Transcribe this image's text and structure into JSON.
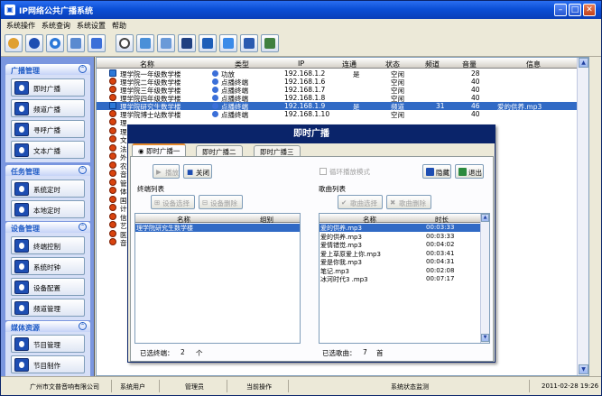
{
  "window": {
    "title": "IP网络公共广播系统"
  },
  "menu": [
    "系统操作",
    "系统查询",
    "系统设置",
    "帮助"
  ],
  "toolbar_icons": [
    "users-icon",
    "broadcast-icon",
    "spinner-icon",
    "edit-icon",
    "book-icon",
    "clock-icon",
    "folder-icon",
    "tree-icon",
    "monitor-icon",
    "antenna-icon",
    "snow-icon",
    "film-icon",
    "exit-icon"
  ],
  "sidebar": {
    "groups": [
      {
        "title": "广播管理",
        "items": [
          "即时广播",
          "频道广播",
          "寻呼广播",
          "文本广播"
        ]
      },
      {
        "title": "任务管理",
        "items": [
          "系统定时",
          "本地定时"
        ]
      },
      {
        "title": "设备管理",
        "items": [
          "终端控制",
          "系统时钟",
          "设备配置",
          "频道管理"
        ]
      },
      {
        "title": "媒体资源",
        "items": [
          "节目管理",
          "节目制作"
        ]
      }
    ]
  },
  "grid": {
    "columns": [
      "名称",
      "类型",
      "IP",
      "连通",
      "状态",
      "频道",
      "音量",
      "信息"
    ],
    "rows": [
      {
        "name": "理学院一年级数学楼",
        "type": "功放",
        "ip": "192.168.1.2",
        "conn": "是",
        "status": "空闲",
        "channel": "",
        "volume": "28",
        "info": "",
        "icon": "net"
      },
      {
        "name": "理学院二年级数学楼",
        "type": "点播终端",
        "ip": "192.168.1.6",
        "conn": "",
        "status": "空闲",
        "channel": "",
        "volume": "40",
        "info": "",
        "icon": "off"
      },
      {
        "name": "理学院三年级数学楼",
        "type": "点播终端",
        "ip": "192.168.1.7",
        "conn": "",
        "status": "空闲",
        "channel": "",
        "volume": "40",
        "info": "",
        "icon": "off"
      },
      {
        "name": "理学院四年级数学楼",
        "type": "点播终端",
        "ip": "192.168.1.8",
        "conn": "",
        "status": "空闲",
        "channel": "",
        "volume": "40",
        "info": "",
        "icon": "off"
      },
      {
        "name": "理学院研究生数学楼",
        "type": "点播终端",
        "ip": "192.168.1.9",
        "conn": "是",
        "status": "频道",
        "channel": "31",
        "volume": "46",
        "info": "爱的供养.mp3",
        "icon": "net",
        "selected": true
      },
      {
        "name": "理学院博士站数学楼",
        "type": "点播终端",
        "ip": "192.168.1.10",
        "conn": "",
        "status": "空闲",
        "channel": "",
        "volume": "40",
        "info": "",
        "icon": "off"
      }
    ],
    "hidden_row_initials": [
      "理",
      "理",
      "文",
      "法",
      "外",
      "农",
      "音",
      "管",
      "体",
      "国",
      "计",
      "信",
      "艺",
      "医",
      "音"
    ]
  },
  "dialog": {
    "title": "即时广播",
    "tabs": [
      "即时广播一",
      "即时广播二",
      "即时广播三"
    ],
    "play_label": "播放",
    "close_label": "关闭",
    "loop_label": "循环播放模式",
    "hide_label": "隐藏",
    "exit_label": "退出",
    "terminal_list": {
      "title": "终端列表",
      "select_label": "设备选择",
      "delete_label": "设备删除",
      "columns": [
        "名称",
        "组别"
      ],
      "rows": [
        {
          "name": "理学院研究生数学楼",
          "group": ""
        }
      ],
      "footer_label": "已选终端：",
      "footer_count": "2",
      "footer_unit": "个"
    },
    "song_list": {
      "title": "歌曲列表",
      "select_label": "歌曲选择",
      "delete_label": "歌曲删除",
      "columns": [
        "名称",
        "时长"
      ],
      "rows": [
        {
          "name": "爱的供养.mp3",
          "duration": "00:03:33",
          "selected": true
        },
        {
          "name": "爱的供养.mp3",
          "duration": "00:03:33"
        },
        {
          "name": "爱情错觉.mp3",
          "duration": "00:04:02"
        },
        {
          "name": "爱上草原爱上你.mp3",
          "duration": "00:03:41"
        },
        {
          "name": "爱是你我.mp3",
          "duration": "00:04:31"
        },
        {
          "name": "笔记.mp3",
          "duration": "00:02:08"
        },
        {
          "name": "冰河时代3 .mp3",
          "duration": "00:07:17"
        }
      ],
      "footer_label": "已选歌曲：",
      "footer_count": "7",
      "footer_unit": "首"
    }
  },
  "status": {
    "company": "广州市文普音响有限公司",
    "user_label": "系统用户",
    "user": "管理员",
    "op_label": "当前操作",
    "op": "系统状态监测",
    "datetime": "2011-02-28 19:26"
  },
  "colors": {
    "accent": "#316ac5",
    "title": "#0a246a",
    "sidebar": "#7a96df"
  }
}
